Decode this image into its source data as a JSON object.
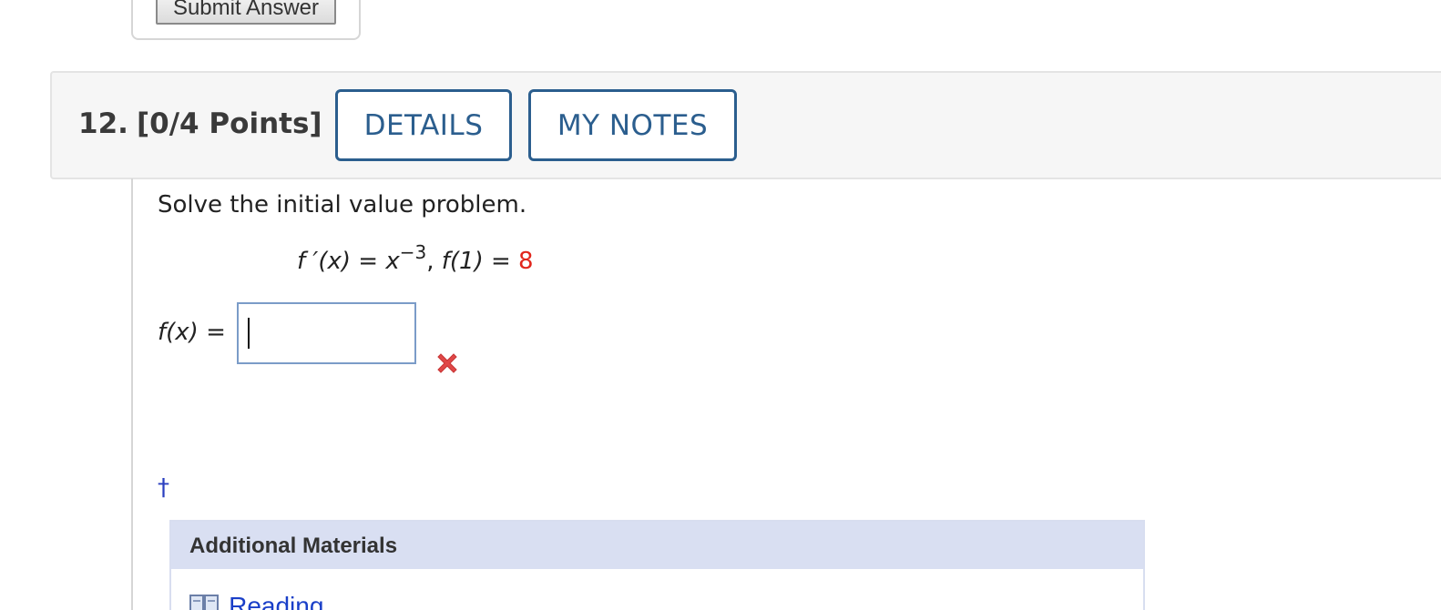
{
  "previous_question": {
    "submit_label": "Submit Answer"
  },
  "question": {
    "number": "12.",
    "points": "[0/4 Points]",
    "details_label": "DETAILS",
    "notes_label": "MY NOTES",
    "prompt": "Solve the initial value problem.",
    "equation": {
      "lhs_fn": "f ′(x)",
      "eq1": " = ",
      "base": "x",
      "exponent": "−3",
      "comma": ", ",
      "cond_fn": "f(1)",
      "eq2": " = ",
      "cond_value": "8"
    },
    "answer": {
      "label_fn": "f(x)",
      "label_eq": " = ",
      "value": "",
      "status": "incorrect"
    },
    "footnote_mark": "†"
  },
  "additional_materials": {
    "title": "Additional Materials",
    "items": [
      {
        "label": "Reading",
        "icon": "book-icon"
      }
    ]
  },
  "colors": {
    "accent": "#2b5e8e",
    "given_value": "#e1261c",
    "incorrect_mark": "#e04848",
    "materials_header": "#d9dff2"
  }
}
